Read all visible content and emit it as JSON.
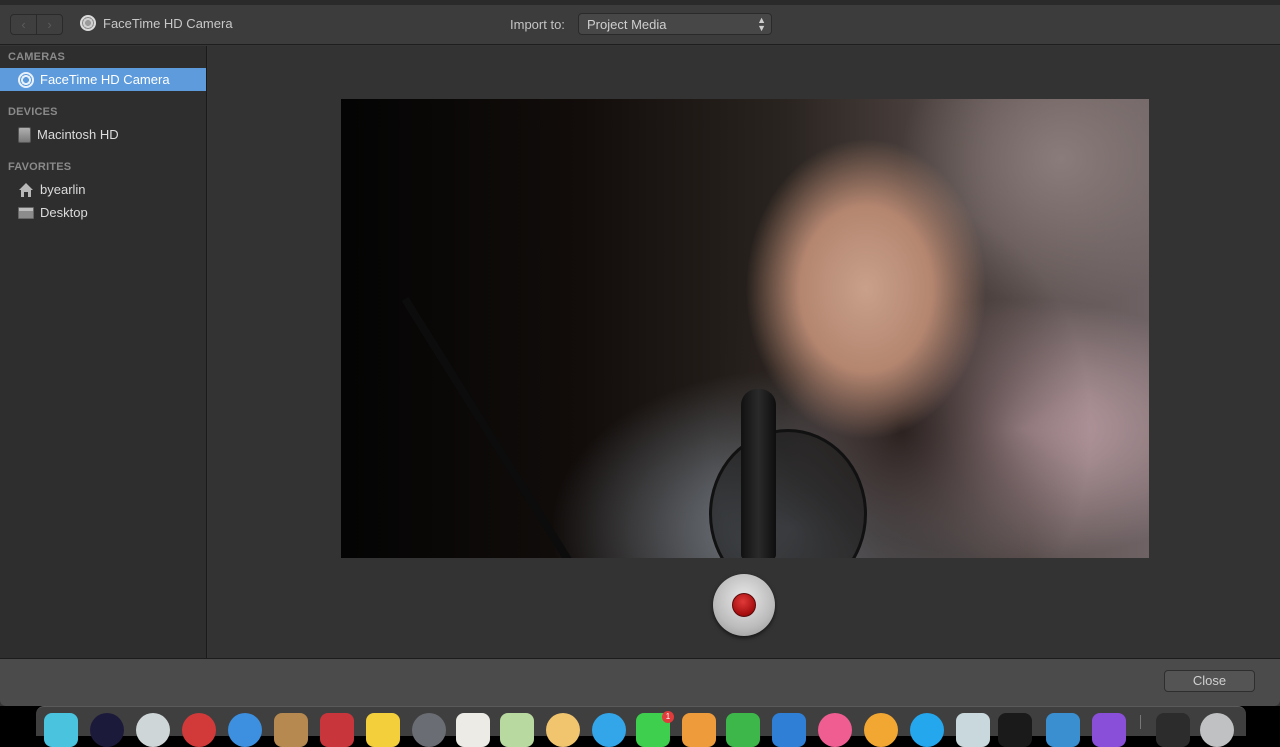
{
  "toolbar": {
    "back_icon": "‹",
    "forward_icon": "›",
    "source_title": "FaceTime HD Camera",
    "import_label": "Import to:",
    "import_value": "Project Media",
    "select_arrows": "⌃⌄"
  },
  "sidebar": {
    "sections": [
      {
        "heading": "CAMERAS",
        "items": [
          {
            "label": "FaceTime HD Camera",
            "icon": "camera-icon",
            "selected": true
          }
        ]
      },
      {
        "heading": "DEVICES",
        "items": [
          {
            "label": "Macintosh HD",
            "icon": "hard-drive-icon",
            "selected": false
          }
        ]
      },
      {
        "heading": "FAVORITES",
        "items": [
          {
            "label": "byearlin",
            "icon": "home-icon",
            "selected": false
          },
          {
            "label": "Desktop",
            "icon": "desktop-folder-icon",
            "selected": false
          }
        ]
      }
    ]
  },
  "preview": {
    "description": "Live camera preview: woman with headscarf and headphones speaking into a microphone"
  },
  "record": {
    "icon": "record-icon"
  },
  "footer": {
    "close_label": "Close"
  },
  "dock": {
    "badge_count": "1",
    "colors": {
      "finder": "#49c3de",
      "launchpad": "#1c1a3a",
      "safari_alt": "#cfd6d8",
      "red_app": "#d23a3a",
      "safari": "#3d8fe0",
      "contacts": "#b5894f",
      "calendar": "#c8353b",
      "notes": "#f2cf3b",
      "system": "#6a6d73",
      "pages": "#ecebe6",
      "maps": "#b8d9a0",
      "photos": "#f1c46e",
      "appstore_blue": "#33a6ea",
      "messages": "#3fcf4e",
      "ibooks": "#ee9b3b",
      "numbers": "#3db74a",
      "keynote": "#2f7fd6",
      "itunes": "#f05d91",
      "ibooks2": "#f3a733",
      "appstore": "#25a7ee",
      "preview_app": "#c9d8dc",
      "terminal": "#1a1a1a",
      "xcode": "#3a8fd0",
      "instruments": "#8a4fd8",
      "downloads": "#2c2c2c",
      "trash": "#bfc1c3"
    }
  }
}
